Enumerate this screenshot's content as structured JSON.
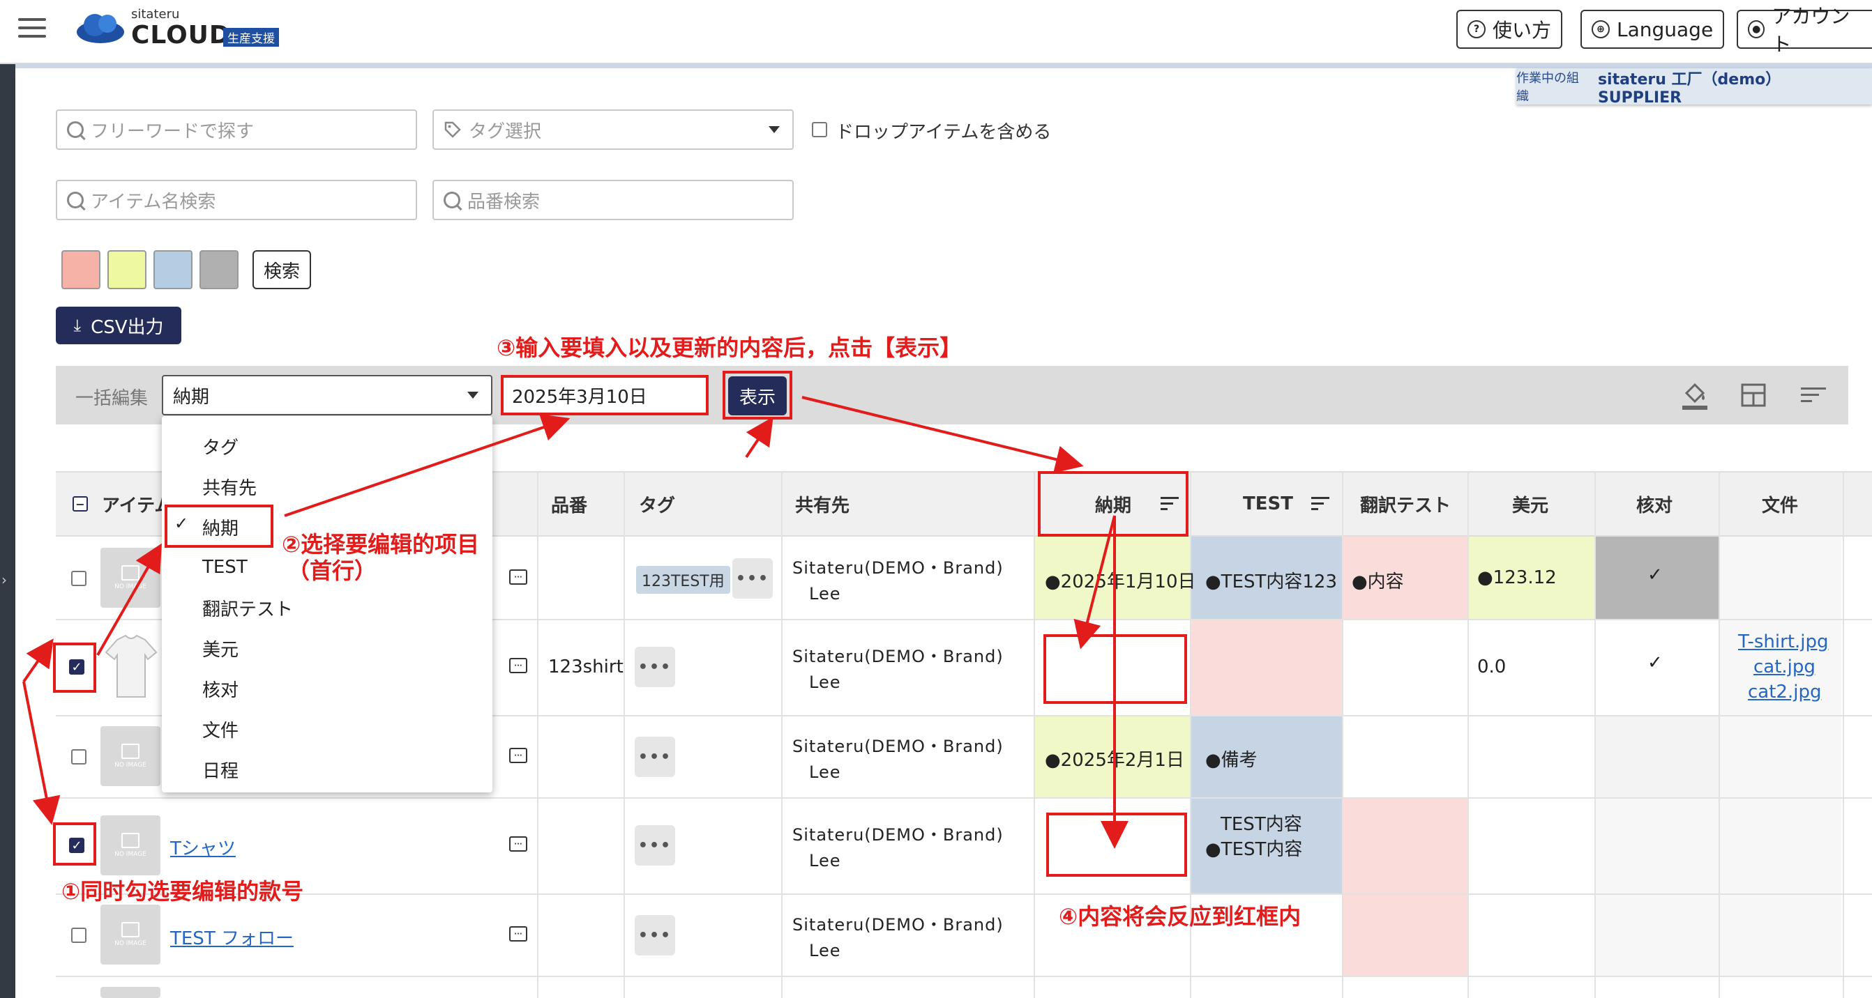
{
  "header": {
    "brand_small": "sitateru",
    "brand_big": "CLOUD",
    "brand_badge": "生産支援",
    "help_label": "使い方",
    "language_label": "Language",
    "account_label": "アカウント",
    "org_label": "作業中の組織",
    "org_value": "sitateru 工厂（demo） SUPPLIER"
  },
  "search": {
    "freeword_placeholder": "フリーワードで探す",
    "tag_placeholder": "タグ選択",
    "include_drop_label": "ドロップアイテムを含める",
    "item_name_placeholder": "アイテム名検索",
    "part_no_placeholder": "品番検索",
    "search_button": "検索",
    "swatch_colors": [
      "#f7b2a8",
      "#eef8a0",
      "#b5cde3",
      "#b0b0b0"
    ]
  },
  "toolbar": {
    "csv_button": "CSV出力",
    "bulk_edit_label": "一括編集",
    "bulk_field_value": "納期",
    "bulk_input_value": "2025年3月10日",
    "display_button": "表示"
  },
  "dropdown": {
    "items": [
      "タグ",
      "共有先",
      "納期",
      "TEST",
      "翻訳テスト",
      "美元",
      "核对",
      "文件",
      "日程"
    ],
    "selected": "納期"
  },
  "table": {
    "headers": {
      "item": "アイテム",
      "part_no": "品番",
      "tag": "タグ",
      "share": "共有先",
      "due": "納期",
      "test": "TEST",
      "translate": "翻訳テスト",
      "usd": "美元",
      "verify": "核对",
      "files": "文件"
    },
    "rows": [
      {
        "checked": false,
        "name": "",
        "part_no": "",
        "tag": "123TEST用",
        "share_org": "Sitateru(DEMO・Brand)",
        "share_user": "Lee",
        "due": "●2025年1月10日",
        "test": "●TEST内容123",
        "translate": "●内容",
        "usd": "●123.12",
        "verify": "✓",
        "files": []
      },
      {
        "checked": true,
        "name": "",
        "part_no": "123shirt",
        "tag": "",
        "share_org": "Sitateru(DEMO・Brand)",
        "share_user": "Lee",
        "due": "",
        "test": "",
        "translate": "",
        "usd": "0.0",
        "verify": "✓",
        "files": [
          "T-shirt.jpg",
          "cat.jpg",
          "cat2.jpg"
        ]
      },
      {
        "checked": false,
        "name": "",
        "part_no": "",
        "tag": "",
        "share_org": "Sitateru(DEMO・Brand)",
        "share_user": "Lee",
        "due": "●2025年2月1日",
        "test": "●備考",
        "translate": "",
        "usd": "",
        "verify": "",
        "files": []
      },
      {
        "checked": true,
        "name": "Tシャツ",
        "part_no": "",
        "tag": "",
        "share_org": "Sitateru(DEMO・Brand)",
        "share_user": "Lee",
        "due": "",
        "test_line1": "TEST内容",
        "test": "●TEST内容",
        "translate": "",
        "usd": "",
        "verify": "",
        "files": []
      },
      {
        "checked": false,
        "name": "TEST フォロー",
        "part_no": "",
        "tag": "",
        "share_org": "Sitateru(DEMO・Brand)",
        "share_user": "Lee",
        "due": "",
        "test": "",
        "translate": "",
        "usd": "",
        "verify": "",
        "files": []
      }
    ],
    "no_image_label": "NO IMAGE"
  },
  "annotations": {
    "step1": "①同时勾选要编辑的款号",
    "step2_line1": "②选择要编辑的项目",
    "step2_line2": "（首行）",
    "step3": "③输入要填入以及更新的内容后，点击【表示】",
    "step4": "④内容将会反应到红框内"
  }
}
